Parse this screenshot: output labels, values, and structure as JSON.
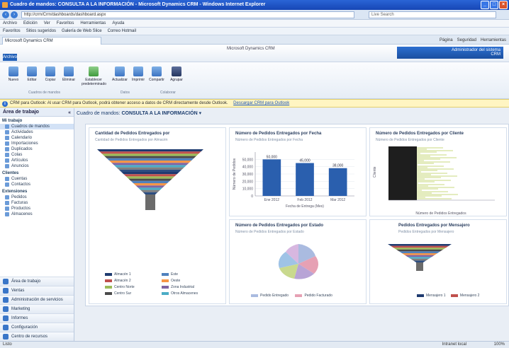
{
  "window": {
    "title": "Cuadro de mandos: CONSULTA A LA INFORMACIÓN - Microsoft Dynamics CRM - Windows Internet Explorer"
  },
  "browser": {
    "url": "http://crm/Crm/dashboards/dashboard.aspx",
    "search_placeholder": "Live Search",
    "menu": [
      "Archivo",
      "Edición",
      "Ver",
      "Favoritos",
      "Herramientas",
      "Ayuda"
    ],
    "favorites": [
      "Favoritos",
      "Sitios sugeridos",
      "Galería de Web Slice",
      "Correo Hotmail"
    ],
    "tab_title": "Microsoft Dynamics CRM",
    "tab_tools": [
      "Página",
      "Seguridad",
      "Herramientas"
    ]
  },
  "crm": {
    "nav_tab": "Archivo",
    "center_label": "Microsoft Dynamics CRM",
    "user_name": "Administrador del sistema",
    "org_name": "CRM"
  },
  "ribbon": {
    "buttons": [
      {
        "label": "Nuevo",
        "color": "blue"
      },
      {
        "label": "Editar",
        "color": "blue"
      },
      {
        "label": "Copiar",
        "color": "blue"
      },
      {
        "label": "Eliminar",
        "color": "blue"
      },
      {
        "label": "Establecer predeterminado",
        "color": "green"
      },
      {
        "label": "Actualizar",
        "color": "blue"
      },
      {
        "label": "Imprimir",
        "color": "blue"
      },
      {
        "label": "Compartir",
        "color": "blue"
      },
      {
        "label": "Agrupar",
        "color": "navy"
      }
    ],
    "groups": [
      "Cuadros de mandos",
      "Datos",
      "Colaborar"
    ]
  },
  "infobar": {
    "text": "CRM para Outlook: Al usar CRM para Outlook, podrá obtener acceso a datos de CRM directamente desde Outlook.",
    "link": "Descargar CRM para Outlook"
  },
  "sidebar": {
    "title": "Área de trabajo",
    "sections": [
      {
        "name": "Mi trabajo",
        "items": [
          "Cuadros de mandos",
          "Actividades",
          "Calendario",
          "Importaciones",
          "Duplicados",
          "Colas",
          "Artículos",
          "Anuncios"
        ]
      },
      {
        "name": "Clientes",
        "items": [
          "Cuentas",
          "Contactos"
        ]
      },
      {
        "name": "Extensiones",
        "items": [
          "Pedidos",
          "Facturas",
          "Productos",
          "Almacenes"
        ]
      }
    ],
    "workspaces": [
      "Área de trabajo",
      "Ventas",
      "Administración de servicios",
      "Marketing",
      "Informes",
      "Configuración",
      "Centro de recursos"
    ]
  },
  "dashboard": {
    "selector_label": "Cuadro de mandos:",
    "name": "CONSULTA A LA INFORMACIÓN"
  },
  "panels": {
    "funnel": {
      "title": "Cantidad de Pedidos Entregados por",
      "subtitle": "Cantidad de Pedidos Entregados por Almacén",
      "legend": [
        {
          "label": "Almacén 1",
          "color": "#1f3b70"
        },
        {
          "label": "Almacén 2",
          "color": "#c0504d"
        },
        {
          "label": "Centro Norte",
          "color": "#9bbb59"
        },
        {
          "label": "Centro Sur",
          "color": "#4a4a4a"
        },
        {
          "label": "Este",
          "color": "#4f81bd"
        },
        {
          "label": "Oeste",
          "color": "#f79646"
        },
        {
          "label": "Zona Industrial",
          "color": "#8064a2"
        },
        {
          "label": "Otros Almacenes",
          "color": "#4bacc6"
        }
      ]
    },
    "bars": {
      "title": "Número de Pedidos Entregados por Fecha",
      "subtitle": "Número de Pedidos Entregados por Fecha",
      "ylabel": "Número de Pedidos",
      "xlabel": "Fecha de Entrega (Mes)"
    },
    "scatter": {
      "title": "Número de Pedidos Entregados por Cliente",
      "subtitle": "Número de Pedidos Entregados por Cliente",
      "ylabel": "Cliente",
      "xlabel": "Número de Pedidos Entregados"
    },
    "pie": {
      "title": "Número de Pedidos Entregados por Estado",
      "subtitle": "Número de Pedidos Entregados por Estado",
      "legend": [
        {
          "label": "Pedido Entregado",
          "color": "#aabbe0"
        },
        {
          "label": "Pedido Facturado",
          "color": "#e6a1b4"
        }
      ]
    },
    "funnel2": {
      "title": "Pedidos Entregados por Mensajero",
      "subtitle": "Pedidos Entregados por Mensajero",
      "legend": [
        {
          "label": "Mensajero 1",
          "color": "#1f3b70"
        },
        {
          "label": "Mensajero 2",
          "color": "#c0504d"
        }
      ]
    }
  },
  "chart_data": [
    {
      "type": "bar",
      "title": "Número de Pedidos Entregados por Fecha",
      "categories": [
        "Ene 2012",
        "Feb 2012",
        "Mar 2012"
      ],
      "values": [
        50000,
        45000,
        38000
      ],
      "data_labels": [
        "50,000",
        "45,000",
        "38,000"
      ],
      "xlabel": "Fecha de Entrega (Mes)",
      "ylabel": "Número de Pedidos",
      "yticks": [
        "0",
        "10,000",
        "20,000",
        "30,000",
        "40,000",
        "50,000"
      ],
      "ylim": [
        0,
        60000
      ]
    }
  ],
  "status": {
    "left": "Listo",
    "zone": "Intranet local",
    "zoom": "100%"
  },
  "colors": {
    "accent": "#2160b8",
    "bar": "#2a5fae",
    "infobar": "#fff5c2"
  }
}
